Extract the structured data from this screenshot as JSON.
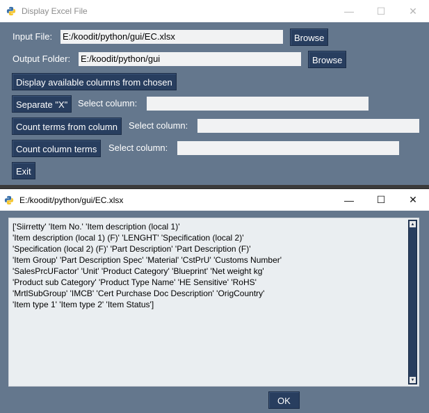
{
  "main_window": {
    "title": "Display Excel File",
    "input_file": {
      "label": "Input File:",
      "value": "E:/koodit/python/gui/EC.xlsx",
      "browse_label": "Browse"
    },
    "output_folder": {
      "label": "Output Folder:",
      "value": "E:/koodit/python/gui",
      "browse_label": "Browse"
    },
    "display_columns_button": "Display available columns from chosen",
    "separate": {
      "button": "Separate \"X\"",
      "select_label": "Select column:",
      "value": ""
    },
    "count_from_column": {
      "button": "Count terms from column",
      "select_label": "Select column:",
      "value": ""
    },
    "count_column_terms": {
      "button": "Count column terms",
      "select_label": "Select column:",
      "value": ""
    },
    "exit_button": "Exit"
  },
  "popup_window": {
    "title": "E:/koodit/python/gui/EC.xlsx",
    "output_lines": [
      "['Siirretty' 'Item No.' 'Item description (local 1)'",
      " 'Item description (local 1) (F)' 'LENGHT' 'Specification (local 2)'",
      " 'Specification (local 2) (F)' 'Part Description' 'Part Description (F)'",
      " 'Item Group' 'Part Description Spec' 'Material' 'CstPrU' 'Customs Number'",
      " 'SalesPrcUFactor' 'Unit' 'Product Category' 'Blueprint' 'Net weight kg'",
      " 'Product sub Category' 'Product Type Name' 'HE Sensitive' 'RoHS'",
      " 'MrtlSubGroup' 'IMCB' 'Cert Purchase Doc Description' 'OrigCountry'",
      " 'Item type 1' 'Item type 2' 'Item Status']"
    ],
    "ok_button": "OK"
  },
  "window_controls": {
    "minimize": "—",
    "maximize": "☐",
    "close": "✕"
  },
  "colors": {
    "window_bg": "#64778d",
    "button_bg": "#283e5f",
    "input_bg": "#f1f2f3"
  }
}
